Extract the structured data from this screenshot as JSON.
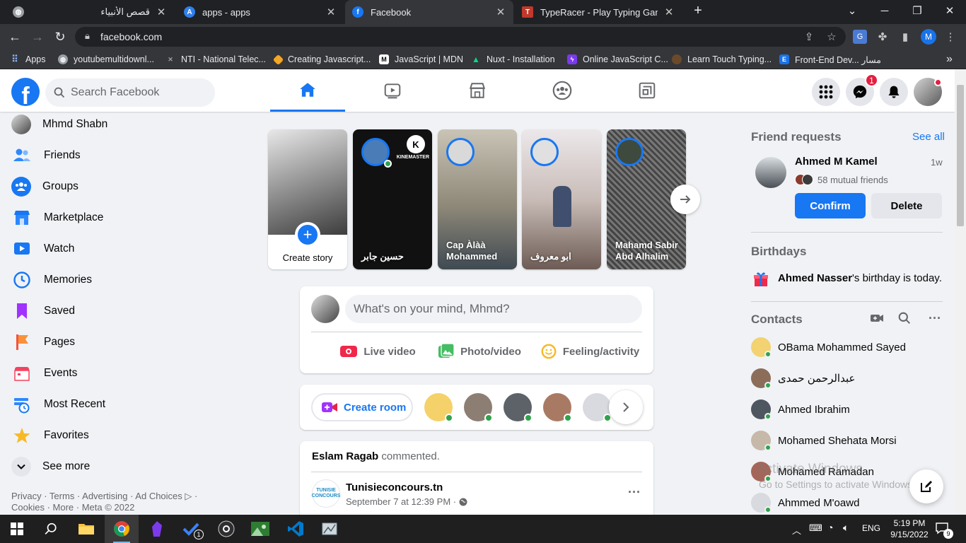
{
  "browser": {
    "tabs": [
      {
        "title": "قصص الأنبياء",
        "active": false
      },
      {
        "title": "apps - apps",
        "active": false
      },
      {
        "title": "Facebook",
        "active": true
      },
      {
        "title": "TypeRacer - Play Typing Games a",
        "active": false
      }
    ],
    "new_tab": "+",
    "url": "facebook.com",
    "profile_initial": "M",
    "bookmarks": [
      {
        "label": "Apps"
      },
      {
        "label": "youtubemultidownl..."
      },
      {
        "label": "NTI - National Telec..."
      },
      {
        "label": "Creating Javascript..."
      },
      {
        "label": "JavaScript | MDN"
      },
      {
        "label": "Nuxt - Installation"
      },
      {
        "label": "Online JavaScript C..."
      },
      {
        "label": "Learn Touch Typing..."
      },
      {
        "label": "Front-End Dev... مسار"
      }
    ],
    "more": "»"
  },
  "header": {
    "search_placeholder": "Search Facebook",
    "messenger_badge": "1"
  },
  "left_nav": {
    "items": [
      {
        "label": "Mhmd Shabn",
        "icon": "avatar"
      },
      {
        "label": "Friends",
        "icon": "friends-icon"
      },
      {
        "label": "Groups",
        "icon": "groups-icon"
      },
      {
        "label": "Marketplace",
        "icon": "marketplace-icon"
      },
      {
        "label": "Watch",
        "icon": "watch-icon"
      },
      {
        "label": "Memories",
        "icon": "memories-icon"
      },
      {
        "label": "Saved",
        "icon": "saved-icon"
      },
      {
        "label": "Pages",
        "icon": "pages-icon"
      },
      {
        "label": "Events",
        "icon": "events-icon"
      },
      {
        "label": "Most Recent",
        "icon": "most-recent-icon"
      },
      {
        "label": "Favorites",
        "icon": "favorites-icon"
      },
      {
        "label": "See more",
        "icon": "chevron-down-icon"
      }
    ],
    "footer_line1": "Privacy · Terms · Advertising · Ad Choices ▷ ·",
    "footer_line2": "Cookies · More · Meta © 2022"
  },
  "stories": {
    "create_label": "Create story",
    "items": [
      {
        "name": "حسين جابر",
        "bg": "#111111"
      },
      {
        "name": "Cap Àlàà Mohammed",
        "bg": "#8e8878"
      },
      {
        "name": "ابو معروف",
        "bg": "#b5aaa2"
      },
      {
        "name": "Mahamd Sabir Abd Alhalim",
        "bg": "#555555"
      }
    ],
    "kinemaster": "KINEMASTER"
  },
  "composer": {
    "placeholder": "What's on your mind, Mhmd?",
    "live_label": "Live video",
    "photo_label": "Photo/video",
    "feeling_label": "Feeling/activity"
  },
  "rooms": {
    "create_label": "Create room"
  },
  "post": {
    "actor": "Eslam Ragab",
    "activity": " commented.",
    "page_name": "Tunisieconcours.tn",
    "page_logo_text": "TUNISIE CONCOURS",
    "date": "September 7 at 12:39 PM ·",
    "more": "···"
  },
  "right_rail": {
    "friend_requests_title": "Friend requests",
    "see_all": "See all",
    "request": {
      "name": "Ahmed M Kamel",
      "time": "1w",
      "mutual": "58 mutual friends",
      "confirm": "Confirm",
      "delete": "Delete"
    },
    "birthdays_title": "Birthdays",
    "birthday_name": "Ahmed Nasser",
    "birthday_text": "'s birthday is today.",
    "contacts_title": "Contacts",
    "contacts": [
      {
        "name": "OBama Mohammed Sayed"
      },
      {
        "name": "عبدالرحمن حمدى"
      },
      {
        "name": "Ahmed Ibrahim"
      },
      {
        "name": "Mohamed Shehata Morsi"
      },
      {
        "name": "Mohamed Ramadan"
      },
      {
        "name": "Ahmmed M'oawd"
      }
    ]
  },
  "watermark": {
    "line1": "Activate Windows",
    "line2": "Go to Settings to activate Windows."
  },
  "taskbar": {
    "lang": "ENG",
    "time": "5:19 PM",
    "date": "9/15/2022",
    "notifications": "9",
    "vscode_badge": "1"
  },
  "colors": {
    "fb_blue": "#1877f2",
    "chrome_dark": "#202124",
    "online_green": "#31a24c"
  }
}
